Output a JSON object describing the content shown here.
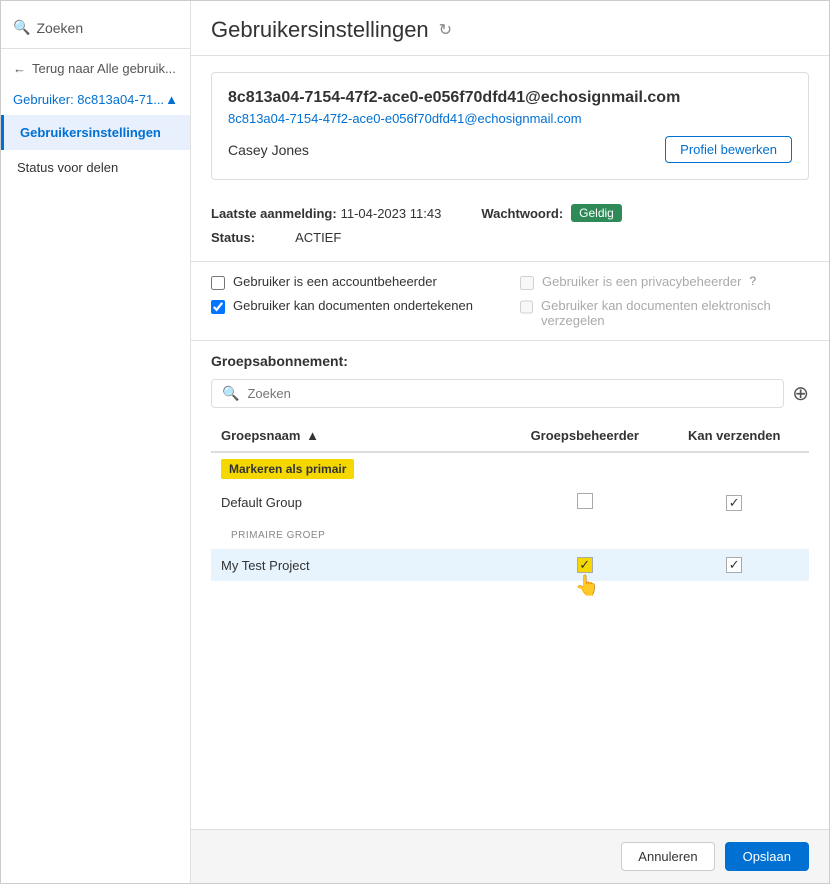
{
  "sidebar": {
    "search_placeholder": "Zoeken",
    "back_label": "Terug naar Alle gebruik...",
    "user_heading": "Gebruiker: 8c813a04-71...",
    "nav_items": [
      {
        "id": "gebruikersinstellingen",
        "label": "Gebruikersinstellingen",
        "active": true
      },
      {
        "id": "status-voor-delen",
        "label": "Status voor delen",
        "active": false
      }
    ]
  },
  "header": {
    "title": "Gebruikersinstellingen"
  },
  "user_card": {
    "email_main": "8c813a04-7154-47f2-ace0-e056f70dfd41@echosignmail.com",
    "email_link": "8c813a04-7154-47f2-ace0-e056f70dfd41@echosignmail.com",
    "name": "Casey Jones",
    "profile_btn": "Profiel bewerken"
  },
  "info": {
    "last_login_label": "Laatste aanmelding:",
    "last_login_value": "11-04-2023 11:43",
    "password_label": "Wachtwoord:",
    "password_badge": "Geldig",
    "status_label": "Status:",
    "status_value": "ACTIEF"
  },
  "checkboxes": {
    "account_admin_label": "Gebruiker is een accountbeheerder",
    "sign_docs_label": "Gebruiker kan documenten ondertekenen",
    "privacy_admin_label": "Gebruiker is een privacybeheerder",
    "seal_docs_label": "Gebruiker kan documenten elektronisch verzegelen",
    "account_admin_checked": false,
    "sign_docs_checked": true,
    "privacy_admin_checked": false,
    "privacy_admin_disabled": true,
    "seal_docs_checked": false,
    "seal_docs_disabled": true
  },
  "group_subscription": {
    "title": "Groepsabonnement:",
    "search_placeholder": "Zoeken",
    "table": {
      "col_group": "Groepsnaam",
      "col_admin": "Groepsbeheerder",
      "col_send": "Kan verzenden",
      "badge_primary_label": "Markeren als primair",
      "label_primary": "PRIMAIRE GROEP",
      "rows": [
        {
          "name": "Default Group",
          "is_primary_group": false,
          "admin_checked": false,
          "send_checked": true,
          "highlight": false
        },
        {
          "name": "My Test Project",
          "is_primary_group": true,
          "admin_checked": true,
          "send_checked": true,
          "highlight": true
        }
      ]
    }
  },
  "footer": {
    "cancel_label": "Annuleren",
    "save_label": "Opslaan"
  },
  "icons": {
    "search": "🔍",
    "back_arrow": "←",
    "chevron_up": "▲",
    "refresh": "↻",
    "plus_circle": "⊕",
    "sort_up": "▲",
    "info": "?",
    "checkmark": "✓",
    "hand": "👆"
  }
}
